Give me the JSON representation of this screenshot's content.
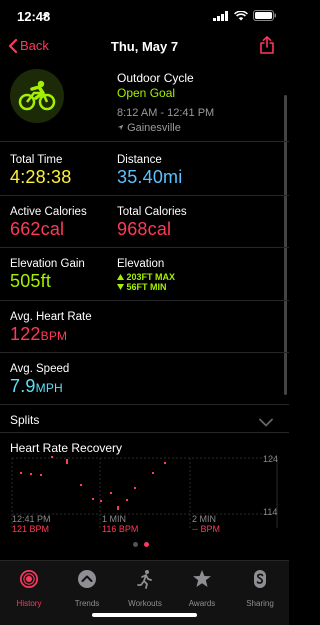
{
  "status": {
    "time": "12:48"
  },
  "nav": {
    "back_label": "Back",
    "title": "Thu, May 7"
  },
  "workout": {
    "type": "Outdoor Cycle",
    "goal": "Open Goal",
    "time_range": "8:12 AM - 12:41 PM",
    "location": "Gainesville"
  },
  "metrics": {
    "total_time_label": "Total Time",
    "total_time_value": "4:28:38",
    "distance_label": "Distance",
    "distance_value": "35.40",
    "distance_unit": "mi",
    "active_cal_label": "Active Calories",
    "active_cal_value": "662",
    "active_cal_unit": "cal",
    "total_cal_label": "Total Calories",
    "total_cal_value": "968",
    "total_cal_unit": "cal",
    "elev_gain_label": "Elevation Gain",
    "elev_gain_value": "505",
    "elev_gain_unit": "ft",
    "elevation_label": "Elevation",
    "elevation_max": "203FT MAX",
    "elevation_min": "56FT MIN",
    "avg_hr_label": "Avg. Heart Rate",
    "avg_hr_value": "122",
    "avg_hr_unit": "BPM",
    "avg_speed_label": "Avg. Speed",
    "avg_speed_value": "7.9",
    "avg_speed_unit": "MPH"
  },
  "splits": {
    "label": "Splits"
  },
  "heart_rate_recovery": {
    "title": "Heart Rate Recovery",
    "y_max": "124",
    "y_min": "114",
    "markers": [
      {
        "time": "12:41 PM",
        "bpm": "121 BPM"
      },
      {
        "time": "1 MIN",
        "bpm": "116 BPM"
      },
      {
        "time": "2 MIN",
        "bpm": "-- BPM"
      }
    ]
  },
  "tabs": [
    {
      "label": "History",
      "icon": "history-rings-icon",
      "active": true
    },
    {
      "label": "Trends",
      "icon": "trends-chevron-icon",
      "active": false
    },
    {
      "label": "Workouts",
      "icon": "running-figure-icon",
      "active": false
    },
    {
      "label": "Awards",
      "icon": "star-award-icon",
      "active": false
    },
    {
      "label": "Sharing",
      "icon": "sharing-s-icon",
      "active": false
    }
  ],
  "colors": {
    "accent": "#ff375f",
    "green": "#a5f000",
    "blue": "#5ec1ff",
    "yellow": "#fff03a",
    "red": "#ff3a55",
    "cyan": "#5fe0f6"
  }
}
